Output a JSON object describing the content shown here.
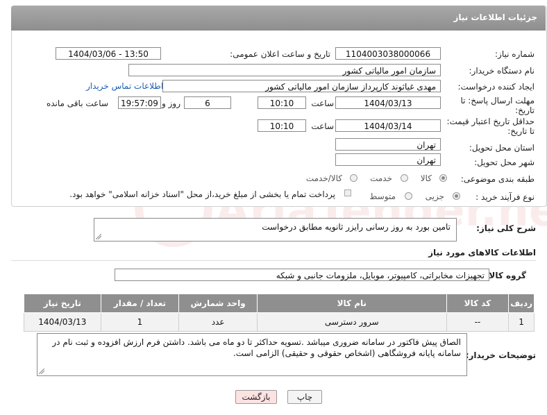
{
  "header": {
    "title": "جزئیات اطلاعات نیاز"
  },
  "form": {
    "need_number_label": "شماره نیاز:",
    "need_number": "1104003038000066",
    "announce_label": "تاریخ و ساعت اعلان عمومی:",
    "announce_value": "1404/03/06 - 13:50",
    "buyer_org_label": "نام دستگاه خریدار:",
    "buyer_org": "سازمان امور مالیاتی کشور",
    "creator_label": "ایجاد کننده درخواست:",
    "creator": "مهدی غیاثوند کارپرداز سازمان امور مالیاتی کشور",
    "contact_link": "اطلاعات تماس خریدار",
    "deadline_label_1": "مهلت ارسال پاسخ: تا",
    "deadline_label_2": "تاریخ:",
    "deadline_date": "1404/03/13",
    "time_label": "ساعت",
    "deadline_time": "10:10",
    "days_value": "6",
    "days_label": "روز و",
    "remaining_time": "19:57:09",
    "remaining_label": "ساعت باقی مانده",
    "price_label_1": "حداقل تاریخ اعتبار قیمت:",
    "price_label_2": "تا تاریخ:",
    "price_date": "1404/03/14",
    "price_time": "10:10",
    "province_label": "استان محل تحویل:",
    "province": "تهران",
    "city_label": "شهر محل تحویل:",
    "city": "تهران",
    "category_label": "طبقه بندی موضوعی:",
    "category_options": [
      "کالا",
      "خدمت",
      "کالا/خدمت"
    ],
    "process_label": "نوع فرآیند خرید :",
    "process_options": [
      "جزیی",
      "متوسط"
    ],
    "payment_note": "پرداخت تمام یا بخشی از مبلغ خرید،از محل \"اسناد خزانه اسلامی\" خواهد بود."
  },
  "description": {
    "label": "شرح کلی نیاز:",
    "text": "تامین بورد به روز رسانی رایزر ثانویه مطابق درخواست"
  },
  "goods": {
    "section_title": "اطلاعات کالاهای مورد نیاز",
    "group_label": "گروه کالا:",
    "group_value": "تجهیزات مخابراتی، کامپیوتر، موبایل، ملزومات جانبی و شبکه",
    "columns": [
      "ردیف",
      "کد کالا",
      "نام کالا",
      "واحد شمارش",
      "تعداد / مقدار",
      "تاریخ نیاز"
    ],
    "rows": [
      [
        "1",
        "--",
        "سرور دسترسی",
        "عدد",
        "1",
        "1404/03/13"
      ]
    ]
  },
  "notes": {
    "label": "توضیحات خریدار:",
    "line1": "الصاق پیش فاکتور در سامانه ضروری میباشد .تسویه حداکثر تا دو ماه می باشد.  داشتن فرم ارزش افزوده و ثبت نام در",
    "line2": "سامانه پایانه فروشگاهی (اشخاص حقوقی و حقیقی) الزامی است."
  },
  "buttons": {
    "print": "چاپ",
    "back": "بازگشت"
  },
  "watermark": "AriaTender.neT"
}
